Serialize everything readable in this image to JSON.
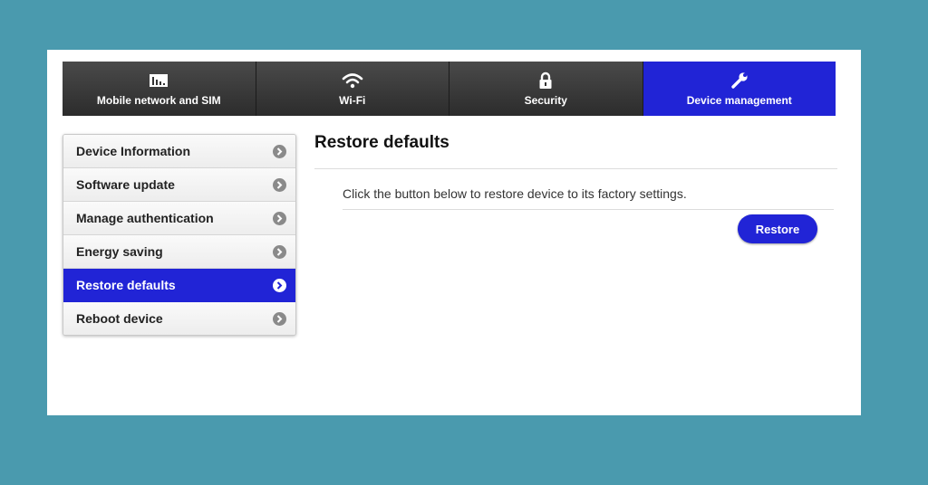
{
  "nav": {
    "tabs": [
      {
        "label": "Mobile network and SIM",
        "icon": "sim-card-icon"
      },
      {
        "label": "Wi-Fi",
        "icon": "wifi-icon"
      },
      {
        "label": "Security",
        "icon": "lock-icon"
      },
      {
        "label": "Device management",
        "icon": "wrench-icon"
      }
    ],
    "active_tab": "Device management",
    "active_color": "#2124d6"
  },
  "sidebar": {
    "items": [
      {
        "label": "Device Information"
      },
      {
        "label": "Software update"
      },
      {
        "label": "Manage authentication"
      },
      {
        "label": "Energy saving"
      },
      {
        "label": "Restore defaults"
      },
      {
        "label": "Reboot device"
      }
    ],
    "active_item": "Restore defaults"
  },
  "main": {
    "title": "Restore defaults",
    "description": "Click the button below to restore device to its factory settings.",
    "restore_label": "Restore"
  }
}
